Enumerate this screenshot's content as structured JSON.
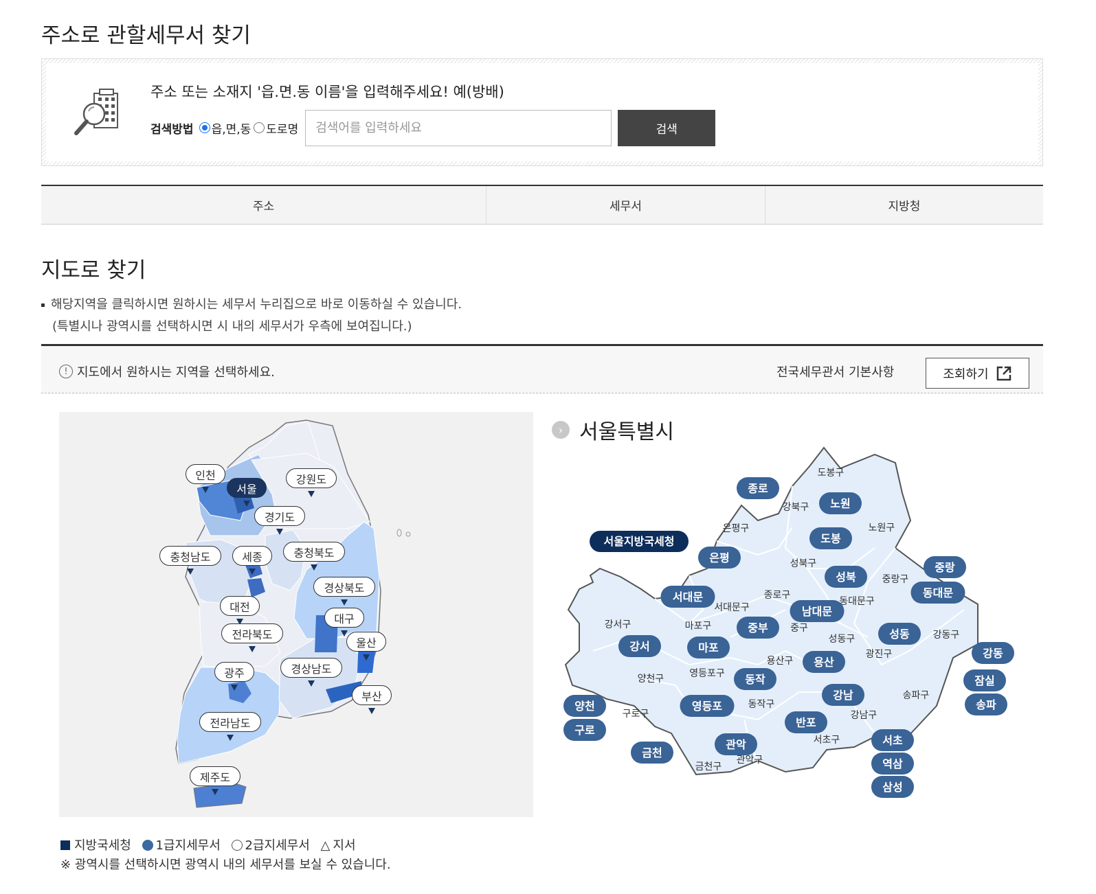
{
  "address_search": {
    "title": "주소로 관할세무서 찾기",
    "message": "주소 또는 소재지 '읍.면.동 이름'을 입력해주세요! 예(방배)",
    "method_label": "검색방법",
    "method_options": [
      "읍,면,동",
      "도로명"
    ],
    "selected_method": "읍,면,동",
    "input_placeholder": "검색어를 입력하세요",
    "search_button": "검색"
  },
  "result_table": {
    "columns": [
      "주소",
      "세무서",
      "지방청"
    ]
  },
  "map_search": {
    "title": "지도로 찾기",
    "desc_line1": "해당지역을 클릭하시면 원하시는 세무서 누리집으로 바로 이동하실 수 있습니다.",
    "desc_line2": "(특별시나 광역시를 선택하시면 시 내의 세무서가 우측에 보여집니다.)",
    "notice": "지도에서 원하시는 지역을 선택하세요.",
    "basic_info_label": "전국세무관서 기본사항",
    "query_button": "조회하기"
  },
  "korea_map": {
    "regions": [
      "인천",
      "서울",
      "강원도",
      "경기도",
      "충청남도",
      "세종",
      "충청북도",
      "경상북도",
      "대전",
      "대구",
      "전라북도",
      "울산",
      "광주",
      "경상남도",
      "부산",
      "전라남도",
      "제주도"
    ],
    "selected": "서울"
  },
  "seoul_map": {
    "title": "서울특별시",
    "regional_office": "서울지방국세청",
    "offices": [
      "종로",
      "노원",
      "도봉",
      "은평",
      "성북",
      "중랑",
      "서대문",
      "남대문",
      "동대문",
      "중부",
      "성동",
      "강서",
      "마포",
      "강동",
      "용산",
      "동작",
      "잠실",
      "양천",
      "영등포",
      "강남",
      "송파",
      "구로",
      "반포",
      "관악",
      "서초",
      "금천",
      "역삼",
      "삼성"
    ],
    "districts": [
      "도봉구",
      "강북구",
      "노원구",
      "은평구",
      "성북구",
      "중랑구",
      "종로구",
      "동대문구",
      "서대문구",
      "강서구",
      "마포구",
      "중구",
      "성동구",
      "강동구",
      "광진구",
      "용산구",
      "양천구",
      "영등포구",
      "송파구",
      "구로구",
      "동작구",
      "강남구",
      "서초구",
      "금천구",
      "관악구"
    ]
  },
  "legend": {
    "regional_office": "지방국세청",
    "first_class": "1급지세무서",
    "second_class": "2급지세무서",
    "branch": "지서",
    "note": "※ 광역시를 선택하시면 광역시 내의 세무서를 보실 수 있습니다."
  }
}
